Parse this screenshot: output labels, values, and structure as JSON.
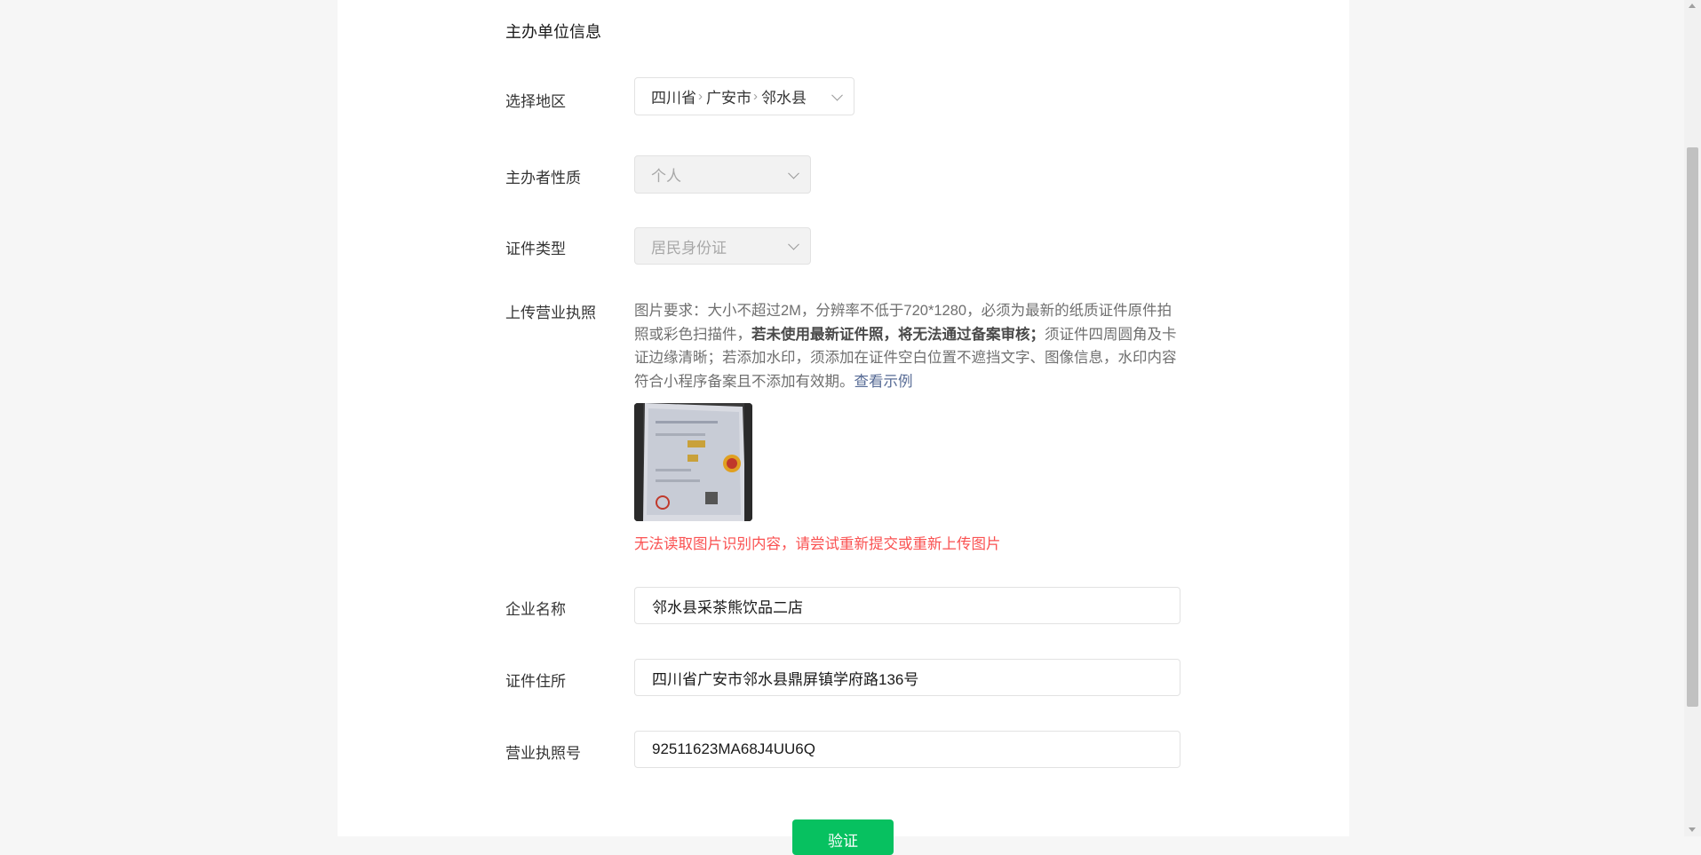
{
  "section_title": "主办单位信息",
  "fields": {
    "region": {
      "label": "选择地区",
      "province": "四川省",
      "city": "广安市",
      "county": "邻水县"
    },
    "host_type": {
      "label": "主办者性质",
      "value": "个人"
    },
    "id_type": {
      "label": "证件类型",
      "value": "居民身份证"
    },
    "license_upload": {
      "label": "上传营业执照",
      "hint_part1": "图片要求：大小不超过2M，分辨率不低于720*1280，必须为最新的纸质证件原件拍照或彩色扫描件，",
      "hint_bold": "若未使用最新证件照，将无法通过备案审核；",
      "hint_part2": "须证件四周圆角及卡证边缘清晰；若添加水印，须添加在证件空白位置不遮挡文字、图像信息，水印内容符合小程序备案且不添加有效期。",
      "example_link": "查看示例",
      "error": "无法读取图片识别内容，请尝试重新提交或重新上传图片"
    },
    "company_name": {
      "label": "企业名称",
      "value": "邻水县采茶熊饮品二店"
    },
    "address": {
      "label": "证件住所",
      "value": "四川省广安市邻水县鼎屏镇学府路136号"
    },
    "license_number": {
      "label": "营业执照号",
      "value": "92511623MA68J4UU6Q"
    }
  },
  "verify_button": "验证",
  "colors": {
    "primary": "#07c160",
    "error": "#fa5151",
    "link": "#576b95"
  }
}
